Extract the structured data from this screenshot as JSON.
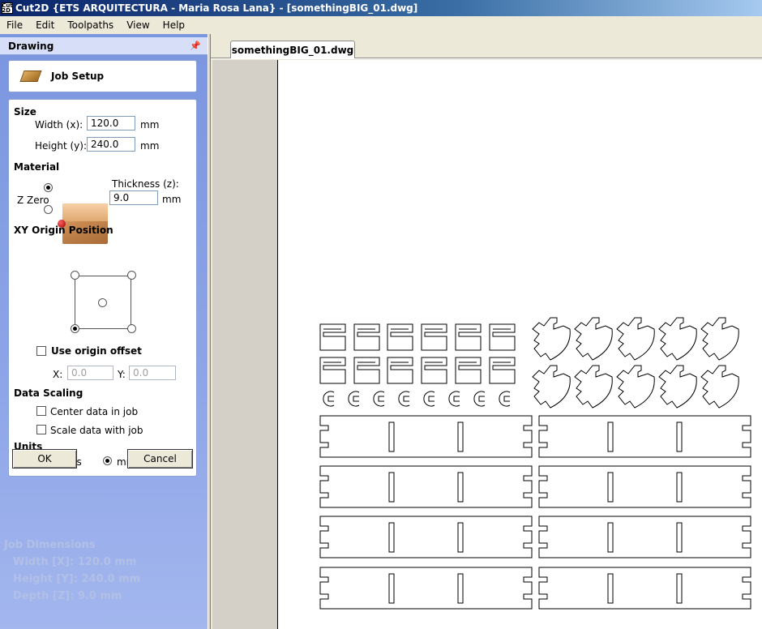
{
  "window": {
    "title": "Cut2D {ETS ARQUITECTURA - Maria Rosa Lana} - [somethingBIG_01.dwg]",
    "app_icon": "Cut 2D"
  },
  "menu": [
    "File",
    "Edit",
    "Toolpaths",
    "View",
    "Help"
  ],
  "panel": {
    "title": "Drawing",
    "pin_icon": "pin-icon",
    "job_setup_label": "Job Setup",
    "size": {
      "heading": "Size",
      "width_label": "Width (x):",
      "width_value": "120.0",
      "width_unit": "mm",
      "height_label": "Height (y):",
      "height_value": "240.0",
      "height_unit": "mm"
    },
    "material": {
      "heading": "Material",
      "zzero_label": "Z Zero",
      "thickness_label": "Thickness (z):",
      "thickness_value": "9.0",
      "thickness_unit": "mm",
      "zzero_selected": "top"
    },
    "origin": {
      "heading": "XY Origin Position",
      "selected": "bottom-left",
      "use_offset_label": "Use origin offset",
      "use_offset_checked": false,
      "x_label": "X:",
      "x_value": "0.0",
      "y_label": "Y:",
      "y_value": "0.0"
    },
    "scaling": {
      "heading": "Data Scaling",
      "center_label": "Center data in job",
      "center_checked": false,
      "scale_label": "Scale data with job",
      "scale_checked": false
    },
    "units": {
      "heading": "Units",
      "inches_label": "inches",
      "mm_label": "mm",
      "selected": "mm"
    },
    "ok_label": "OK",
    "cancel_label": "Cancel",
    "job_dimensions": {
      "heading": "Job Dimensions",
      "width": "Width  [X]: 120.0 mm",
      "height": "Height [Y]: 240.0 mm",
      "depth": "Depth  [Z]: 9.0 mm"
    }
  },
  "document": {
    "tab_label": "somethingBIG_01.dwg"
  },
  "colors": {
    "title_bar": "#0a246a",
    "panel_bg": "#8ea6e8",
    "canvas_bg": "#ffffff",
    "vector_stroke": "#000000"
  }
}
